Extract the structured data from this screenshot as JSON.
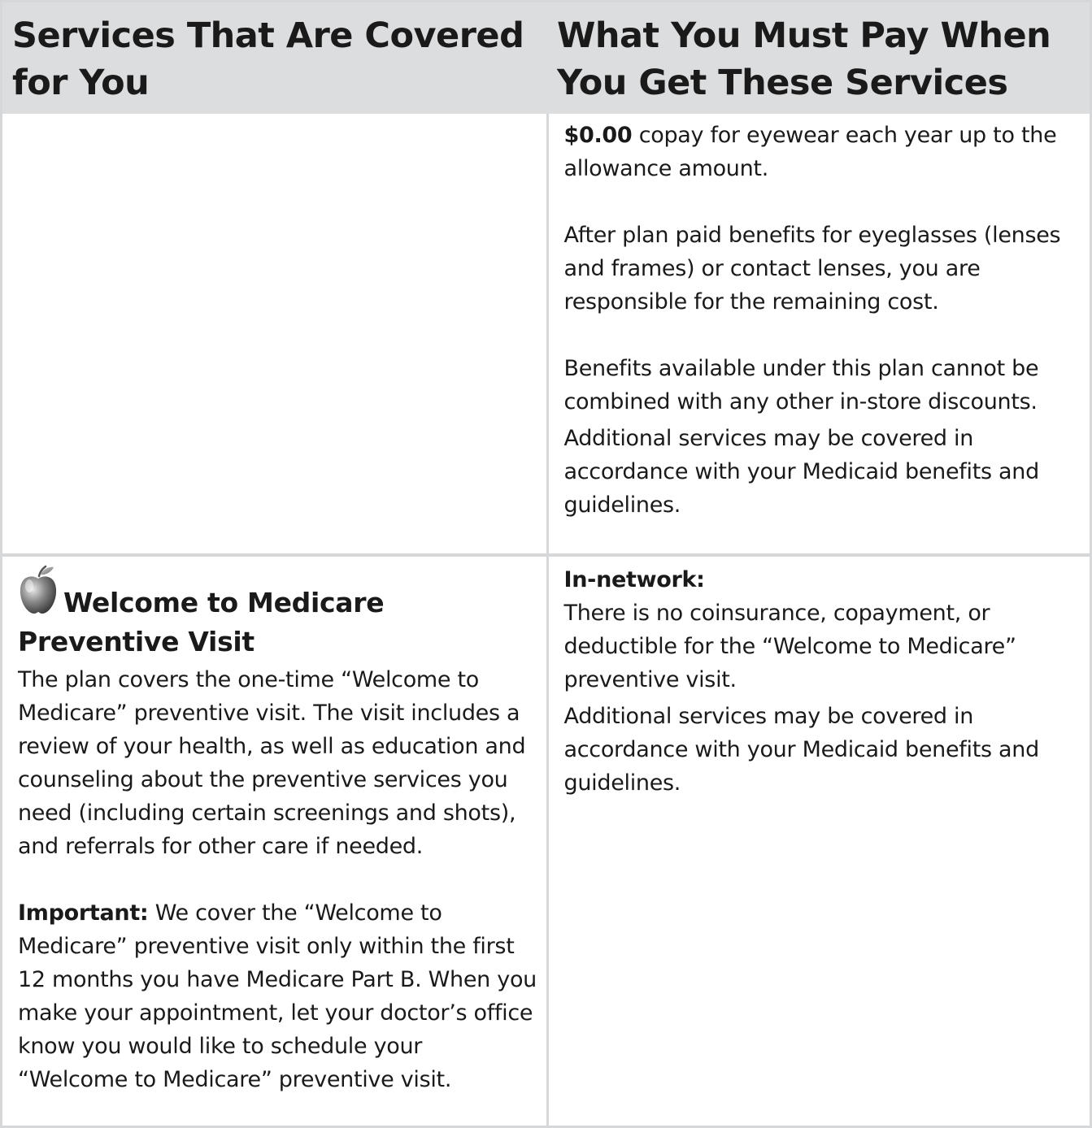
{
  "header": {
    "col1": "Services That Are Covered for You",
    "col2": "What You Must Pay When You Get These Services"
  },
  "eyewear": {
    "copay_amount": "$0.00",
    "copay_text": " copay for eyewear each year up to the allowance amount.",
    "remaining_cost": "After plan paid benefits for eyeglasses (lenses and frames) or contact lenses, you are responsible for the remaining cost.",
    "no_combine": "Benefits available under this plan cannot be combined with any other in-store discounts.",
    "medicaid_note": "Additional services may be covered in accordance with your Medicaid benefits and guidelines."
  },
  "welcome_visit": {
    "icon": "apple-icon",
    "title": "Welcome to Medicare Preventive Visit",
    "description": "The plan covers the one-time “Welcome to Medicare” preventive visit. The visit includes a review of your health, as well as education and counseling about the preventive services you need (including certain screenings and shots), and referrals for other care if needed.",
    "important_label": "Important:",
    "important_text": " We cover the “Welcome to Medicare” preventive visit only within the first 12 months you have Medicare Part B. When you make your appointment, let your doctor’s office know you would like to schedule your “Welcome to Medicare” preventive visit.",
    "network_label": "In-network:",
    "network_text": "There is no coinsurance, copayment, or deductible for the “Welcome to Medicare” preventive visit.",
    "medicaid_note": "Additional services may be covered in accordance with your Medicaid benefits and guidelines."
  }
}
